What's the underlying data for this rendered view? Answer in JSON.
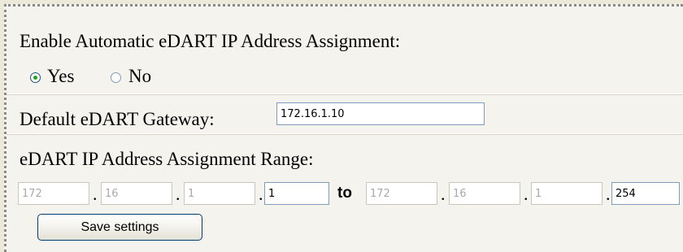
{
  "settings": {
    "auto_assign_label": "Enable Automatic eDART IP Address Assignment:",
    "auto_assign_options": [
      {
        "label": "Yes",
        "selected": true
      },
      {
        "label": "No",
        "selected": false
      }
    ],
    "gateway_label": "Default eDART Gateway:",
    "gateway_value": "172.16.1.10",
    "range_label": "eDART IP Address Assignment Range:",
    "range_start": {
      "octets": [
        "172",
        "16",
        "1",
        "1"
      ],
      "disabled": [
        true,
        true,
        true,
        false
      ]
    },
    "range_to_label": "to",
    "range_end": {
      "octets": [
        "172",
        "16",
        "1",
        "254"
      ],
      "disabled": [
        true,
        true,
        true,
        false
      ]
    },
    "save_label": "Save settings"
  },
  "colors": {
    "background": "#f4f3ee",
    "radio_selected": "#21a121",
    "button_border": "#003c74",
    "input_border": "#7f9db9"
  }
}
